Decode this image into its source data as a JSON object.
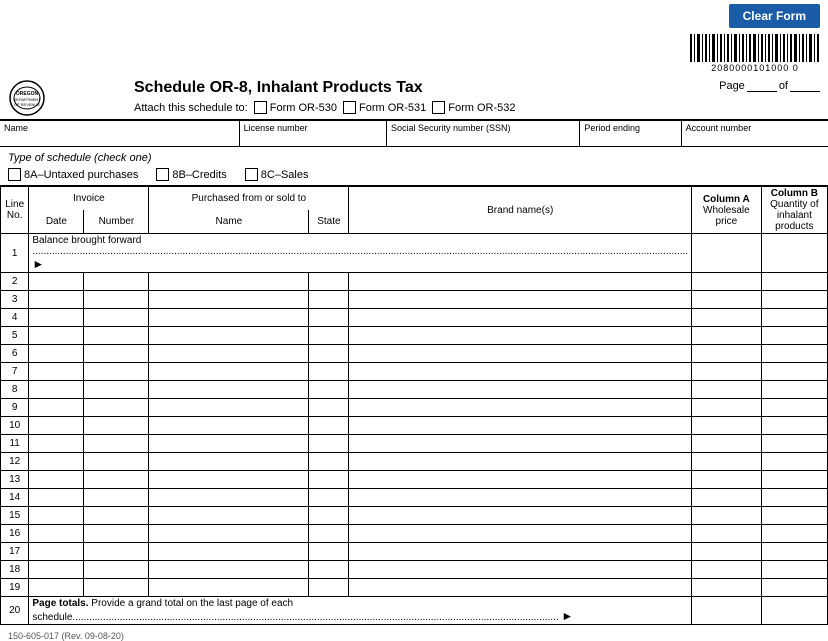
{
  "clearForm": "Clear Form",
  "barcode": {
    "number": "2080000101000 0"
  },
  "logo": {
    "state": "OREGON",
    "dept1": "DEPARTMENT",
    "dept2": "OF REVENUE"
  },
  "header": {
    "title": "Schedule OR-8, Inhalant Products Tax",
    "attachLabel": "Attach this schedule to:",
    "form530": "Form OR-530",
    "form531": "Form OR-531",
    "form532": "Form OR-532",
    "pageLabel": "Page",
    "ofLabel": "of"
  },
  "infoFields": {
    "nameLabel": "Name",
    "licenseLabel": "License number",
    "ssnLabel": "Social Security number (SSN)",
    "periodLabel": "Period ending",
    "accountLabel": "Account number"
  },
  "scheduleType": {
    "label": "Type of schedule",
    "checkOne": "(check one)",
    "options": [
      "8A–Untaxed purchases",
      "8B–Credits",
      "8C–Sales"
    ]
  },
  "table": {
    "headers": {
      "invoiceGroup": "Invoice",
      "purchasedGroup": "Purchased from or sold to",
      "lineNo": "Line\nNo.",
      "date": "Date",
      "number": "Number",
      "name": "Name",
      "state": "State",
      "brand": "Brand name(s)",
      "columnA": "Column A",
      "wholesalePrice": "Wholesale\nprice",
      "columnB": "Column B",
      "quantityInhalant": "Quantity of inhalant\nproducts"
    },
    "rows": [
      {
        "line": 1,
        "balance": "Balance brought forward",
        "isBalance": true
      },
      {
        "line": 2
      },
      {
        "line": 3
      },
      {
        "line": 4
      },
      {
        "line": 5
      },
      {
        "line": 6
      },
      {
        "line": 7
      },
      {
        "line": 8
      },
      {
        "line": 9
      },
      {
        "line": 10
      },
      {
        "line": 11
      },
      {
        "line": 12
      },
      {
        "line": 13
      },
      {
        "line": 14
      },
      {
        "line": 15
      },
      {
        "line": 16
      },
      {
        "line": 17
      },
      {
        "line": 18
      },
      {
        "line": 19
      }
    ],
    "totalsRow": {
      "line": 20,
      "label": "Page totals.",
      "labelBold": "Page totals.",
      "description": " Provide a grand total on the last page of each schedule"
    }
  },
  "footer": {
    "formNumber": "150-605-017 (Rev. 09-08-20)"
  }
}
